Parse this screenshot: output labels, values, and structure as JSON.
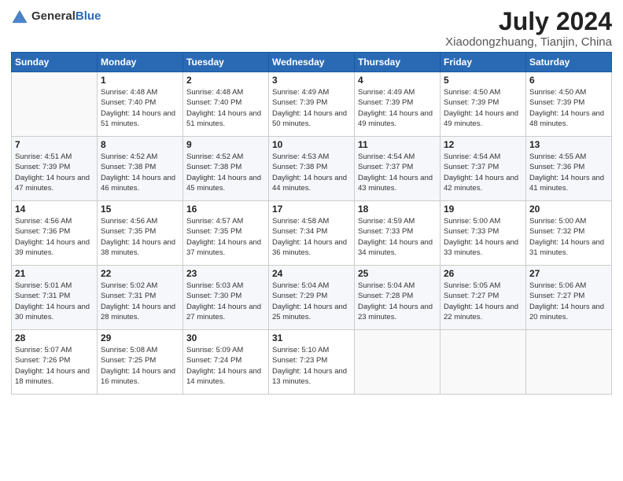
{
  "header": {
    "logo_general": "General",
    "logo_blue": "Blue",
    "month_year": "July 2024",
    "location": "Xiaodongzhuang, Tianjin, China"
  },
  "weekdays": [
    "Sunday",
    "Monday",
    "Tuesday",
    "Wednesday",
    "Thursday",
    "Friday",
    "Saturday"
  ],
  "weeks": [
    [
      {
        "day": "",
        "sunrise": "",
        "sunset": "",
        "daylight": ""
      },
      {
        "day": "1",
        "sunrise": "Sunrise: 4:48 AM",
        "sunset": "Sunset: 7:40 PM",
        "daylight": "Daylight: 14 hours and 51 minutes."
      },
      {
        "day": "2",
        "sunrise": "Sunrise: 4:48 AM",
        "sunset": "Sunset: 7:40 PM",
        "daylight": "Daylight: 14 hours and 51 minutes."
      },
      {
        "day": "3",
        "sunrise": "Sunrise: 4:49 AM",
        "sunset": "Sunset: 7:39 PM",
        "daylight": "Daylight: 14 hours and 50 minutes."
      },
      {
        "day": "4",
        "sunrise": "Sunrise: 4:49 AM",
        "sunset": "Sunset: 7:39 PM",
        "daylight": "Daylight: 14 hours and 49 minutes."
      },
      {
        "day": "5",
        "sunrise": "Sunrise: 4:50 AM",
        "sunset": "Sunset: 7:39 PM",
        "daylight": "Daylight: 14 hours and 49 minutes."
      },
      {
        "day": "6",
        "sunrise": "Sunrise: 4:50 AM",
        "sunset": "Sunset: 7:39 PM",
        "daylight": "Daylight: 14 hours and 48 minutes."
      }
    ],
    [
      {
        "day": "7",
        "sunrise": "Sunrise: 4:51 AM",
        "sunset": "Sunset: 7:39 PM",
        "daylight": "Daylight: 14 hours and 47 minutes."
      },
      {
        "day": "8",
        "sunrise": "Sunrise: 4:52 AM",
        "sunset": "Sunset: 7:38 PM",
        "daylight": "Daylight: 14 hours and 46 minutes."
      },
      {
        "day": "9",
        "sunrise": "Sunrise: 4:52 AM",
        "sunset": "Sunset: 7:38 PM",
        "daylight": "Daylight: 14 hours and 45 minutes."
      },
      {
        "day": "10",
        "sunrise": "Sunrise: 4:53 AM",
        "sunset": "Sunset: 7:38 PM",
        "daylight": "Daylight: 14 hours and 44 minutes."
      },
      {
        "day": "11",
        "sunrise": "Sunrise: 4:54 AM",
        "sunset": "Sunset: 7:37 PM",
        "daylight": "Daylight: 14 hours and 43 minutes."
      },
      {
        "day": "12",
        "sunrise": "Sunrise: 4:54 AM",
        "sunset": "Sunset: 7:37 PM",
        "daylight": "Daylight: 14 hours and 42 minutes."
      },
      {
        "day": "13",
        "sunrise": "Sunrise: 4:55 AM",
        "sunset": "Sunset: 7:36 PM",
        "daylight": "Daylight: 14 hours and 41 minutes."
      }
    ],
    [
      {
        "day": "14",
        "sunrise": "Sunrise: 4:56 AM",
        "sunset": "Sunset: 7:36 PM",
        "daylight": "Daylight: 14 hours and 39 minutes."
      },
      {
        "day": "15",
        "sunrise": "Sunrise: 4:56 AM",
        "sunset": "Sunset: 7:35 PM",
        "daylight": "Daylight: 14 hours and 38 minutes."
      },
      {
        "day": "16",
        "sunrise": "Sunrise: 4:57 AM",
        "sunset": "Sunset: 7:35 PM",
        "daylight": "Daylight: 14 hours and 37 minutes."
      },
      {
        "day": "17",
        "sunrise": "Sunrise: 4:58 AM",
        "sunset": "Sunset: 7:34 PM",
        "daylight": "Daylight: 14 hours and 36 minutes."
      },
      {
        "day": "18",
        "sunrise": "Sunrise: 4:59 AM",
        "sunset": "Sunset: 7:33 PM",
        "daylight": "Daylight: 14 hours and 34 minutes."
      },
      {
        "day": "19",
        "sunrise": "Sunrise: 5:00 AM",
        "sunset": "Sunset: 7:33 PM",
        "daylight": "Daylight: 14 hours and 33 minutes."
      },
      {
        "day": "20",
        "sunrise": "Sunrise: 5:00 AM",
        "sunset": "Sunset: 7:32 PM",
        "daylight": "Daylight: 14 hours and 31 minutes."
      }
    ],
    [
      {
        "day": "21",
        "sunrise": "Sunrise: 5:01 AM",
        "sunset": "Sunset: 7:31 PM",
        "daylight": "Daylight: 14 hours and 30 minutes."
      },
      {
        "day": "22",
        "sunrise": "Sunrise: 5:02 AM",
        "sunset": "Sunset: 7:31 PM",
        "daylight": "Daylight: 14 hours and 28 minutes."
      },
      {
        "day": "23",
        "sunrise": "Sunrise: 5:03 AM",
        "sunset": "Sunset: 7:30 PM",
        "daylight": "Daylight: 14 hours and 27 minutes."
      },
      {
        "day": "24",
        "sunrise": "Sunrise: 5:04 AM",
        "sunset": "Sunset: 7:29 PM",
        "daylight": "Daylight: 14 hours and 25 minutes."
      },
      {
        "day": "25",
        "sunrise": "Sunrise: 5:04 AM",
        "sunset": "Sunset: 7:28 PM",
        "daylight": "Daylight: 14 hours and 23 minutes."
      },
      {
        "day": "26",
        "sunrise": "Sunrise: 5:05 AM",
        "sunset": "Sunset: 7:27 PM",
        "daylight": "Daylight: 14 hours and 22 minutes."
      },
      {
        "day": "27",
        "sunrise": "Sunrise: 5:06 AM",
        "sunset": "Sunset: 7:27 PM",
        "daylight": "Daylight: 14 hours and 20 minutes."
      }
    ],
    [
      {
        "day": "28",
        "sunrise": "Sunrise: 5:07 AM",
        "sunset": "Sunset: 7:26 PM",
        "daylight": "Daylight: 14 hours and 18 minutes."
      },
      {
        "day": "29",
        "sunrise": "Sunrise: 5:08 AM",
        "sunset": "Sunset: 7:25 PM",
        "daylight": "Daylight: 14 hours and 16 minutes."
      },
      {
        "day": "30",
        "sunrise": "Sunrise: 5:09 AM",
        "sunset": "Sunset: 7:24 PM",
        "daylight": "Daylight: 14 hours and 14 minutes."
      },
      {
        "day": "31",
        "sunrise": "Sunrise: 5:10 AM",
        "sunset": "Sunset: 7:23 PM",
        "daylight": "Daylight: 14 hours and 13 minutes."
      },
      {
        "day": "",
        "sunrise": "",
        "sunset": "",
        "daylight": ""
      },
      {
        "day": "",
        "sunrise": "",
        "sunset": "",
        "daylight": ""
      },
      {
        "day": "",
        "sunrise": "",
        "sunset": "",
        "daylight": ""
      }
    ]
  ]
}
